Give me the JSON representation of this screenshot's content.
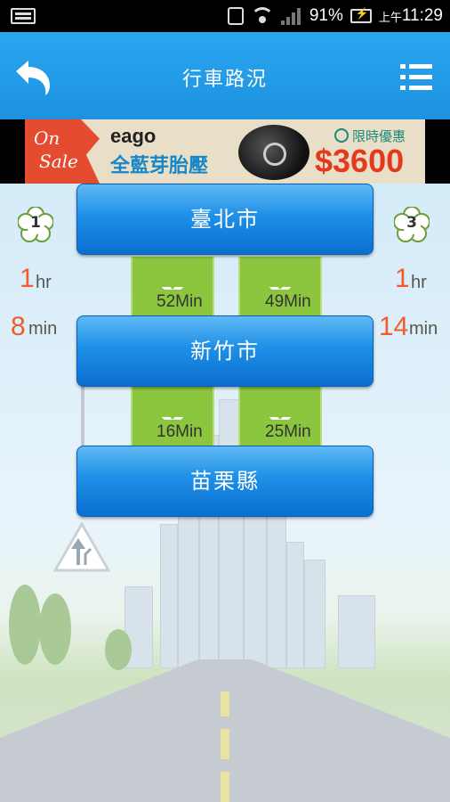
{
  "status_bar": {
    "battery_percent": "91%",
    "ampm": "上午",
    "time": "11:29"
  },
  "app_bar": {
    "title": "行車路況",
    "back_icon": "back-arrow-icon",
    "menu_icon": "list-menu-icon"
  },
  "ad": {
    "on_sale_line1": "On",
    "on_sale_line2": "Sale",
    "brand": "eago",
    "product": "全藍芽胎壓",
    "limited": "限時優惠",
    "price": "$3600"
  },
  "left_route": {
    "badge": "1",
    "segment1_big": "1",
    "segment1_unit": "hr",
    "segment2_big": "8",
    "segment2_unit": "min"
  },
  "right_route": {
    "badge": "3",
    "segment1_big": "1",
    "segment1_unit": "hr",
    "segment2_big": "14",
    "segment2_unit": "min"
  },
  "cities": [
    "臺北市",
    "新竹市",
    "苗栗縣"
  ],
  "legs": {
    "left_1": "52Min",
    "right_1": "49Min",
    "left_2": "16Min",
    "right_2": "25Min"
  },
  "colors": {
    "app_bar": "#1d92de",
    "city_button": "#1e8fe6",
    "leg_bar": "#8cc63f",
    "highlight_number": "#f25b2a",
    "price": "#e33a1c"
  }
}
